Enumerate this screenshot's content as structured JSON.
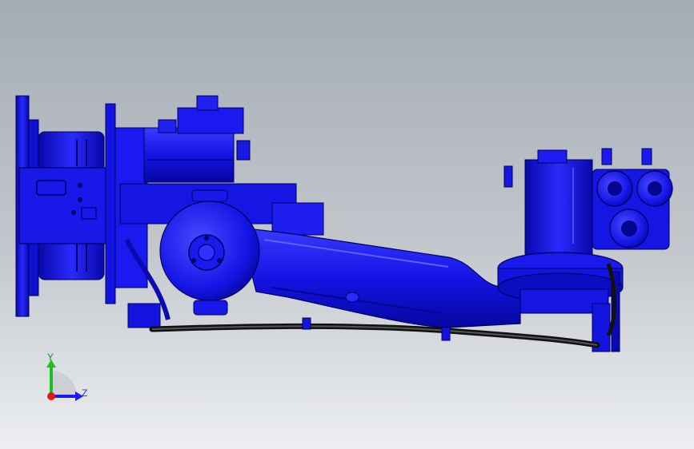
{
  "view": {
    "background_top": "#a4abb5",
    "background_bottom": "#eceef1",
    "model_color": "#1414e6",
    "model_dark": "#05058f",
    "model_light": "#5a5aff",
    "hose_color": "#111111"
  },
  "triad": {
    "y_label": "Y",
    "z_label": "Z",
    "y_color": "#1fbf1f",
    "z_color": "#1a1aff",
    "x_color": "#e01818"
  }
}
